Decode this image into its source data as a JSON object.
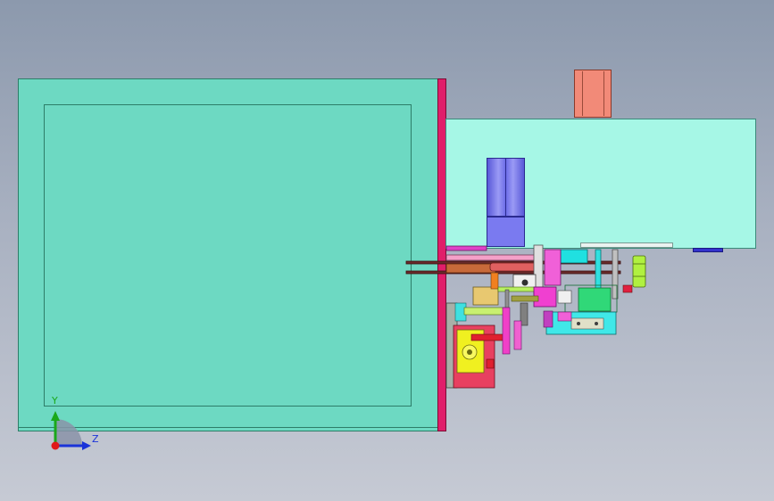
{
  "triad": {
    "y_label": "Y",
    "z_label": "Z"
  },
  "colors": {
    "background_top": "#8c99ad",
    "background_bottom": "#c6cad4",
    "enclosure_fill": "#6dd9c2",
    "enclosure_edge": "#2d7d68",
    "panel_plate": "#e01e6a",
    "machine_box": "#a6f7e6",
    "motor": "#f28a78",
    "cylinder": "#7777ee",
    "y_axis": "#1aa81a",
    "z_axis": "#1a33d9",
    "origin": "#e01a1a"
  }
}
